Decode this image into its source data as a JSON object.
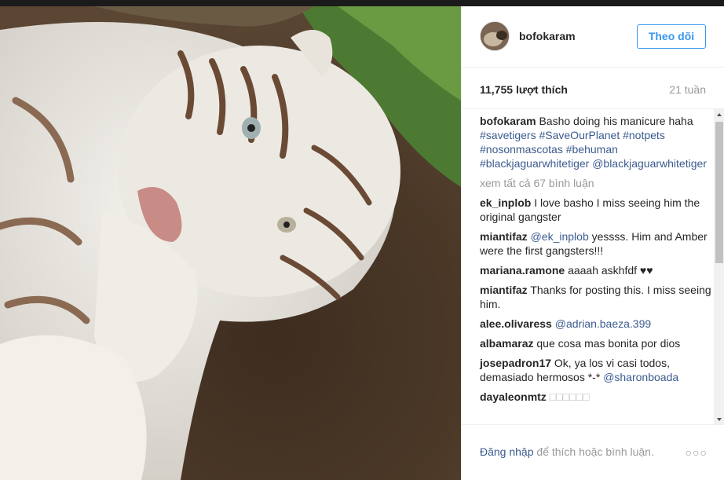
{
  "post": {
    "username": "bofokaram",
    "follow_label": "Theo dõi",
    "likes": "11,755 lượt thích",
    "time": "21 tuần",
    "caption_user": "bofokaram",
    "caption_text": "Basho doing his manicure haha ",
    "caption_tags": [
      "#savetigers",
      "#SaveOurPlanet",
      "#notpets",
      "#nosonmascotas",
      "#behuman",
      "#blackjaguarwhitetiger",
      "@blackjaguarwhitetiger"
    ],
    "view_all": "xem tất cả 67 bình luận"
  },
  "comments": [
    {
      "user": "ek_inplob",
      "text": "I love basho I miss seeing him the original gangster",
      "tag": ""
    },
    {
      "user": "miantifaz",
      "tag": "@ek_inplob",
      "text": " yessss. Him and Amber were the first gangsters!!!"
    },
    {
      "user": "mariana.ramone",
      "text": "aaaah askhfdf ♥♥",
      "tag": ""
    },
    {
      "user": "miantifaz",
      "text": "Thanks for posting this. I miss seeing him.",
      "tag": ""
    },
    {
      "user": "alee.olivaress",
      "tag": "@adrian.baeza.399",
      "text": ""
    },
    {
      "user": "albamaraz",
      "text": "que cosa mas bonita por dios",
      "tag": ""
    },
    {
      "user": "josepadron17",
      "text": "Ok, ya los vi casi todos, demasiado hermosos *-* ",
      "tag": "@sharonboada"
    },
    {
      "user": "dayaleonmtz",
      "text": "□□□□□□",
      "tag": ""
    }
  ],
  "footer": {
    "login_link": "Đăng nhập",
    "login_text": " để thích hoặc bình luận.",
    "more": "○○○"
  },
  "icons": {
    "more": "more-options-icon",
    "scroll_up": "scroll-up-arrow-icon",
    "scroll_down": "scroll-down-arrow-icon"
  }
}
